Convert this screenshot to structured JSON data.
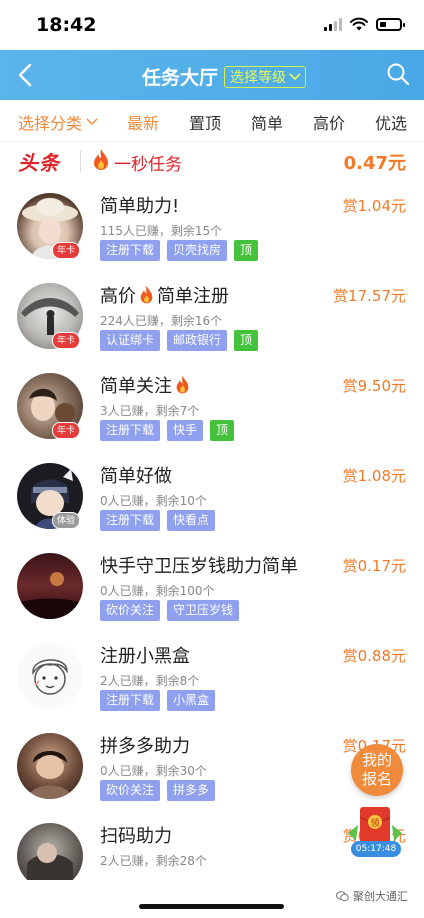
{
  "status_bar": {
    "time": "18:42"
  },
  "header": {
    "title": "任务大厅",
    "level_select": "选择等级"
  },
  "filters": {
    "category": "选择分类",
    "latest": "最新",
    "pinned": "置顶",
    "simple": "简单",
    "high_price": "高价",
    "premium": "优选"
  },
  "headline": {
    "logo": "头条",
    "text": "一秒任务",
    "price": "0.47元"
  },
  "tasks": [
    {
      "title": "简单助力!",
      "fire": false,
      "sub": "115人已赚，剩余15个",
      "price": "赏1.04元",
      "tags": [
        "注册下载",
        "贝壳找房"
      ],
      "top": "顶",
      "badge": "年卡"
    },
    {
      "title_a": "高价",
      "title_b": "简单注册",
      "sub": "224人已赚，剩余16个",
      "price": "赏17.57元",
      "tags": [
        "认证绑卡",
        "邮政银行"
      ],
      "top": "顶",
      "badge": "年卡"
    },
    {
      "title": "简单关注",
      "sub": "3人已赚，剩余7个",
      "price": "赏9.50元",
      "tags": [
        "注册下载",
        "快手"
      ],
      "top": "顶",
      "badge": "年卡"
    },
    {
      "title": "简单好做",
      "sub": "0人已赚，剩余10个",
      "price": "赏1.08元",
      "tags": [
        "注册下载",
        "快看点"
      ],
      "badge": "体验"
    },
    {
      "title": "快手守卫压岁钱助力简单",
      "sub": "0人已赚，剩余100个",
      "price": "赏0.17元",
      "tags": [
        "砍价关注",
        "守卫压岁钱"
      ]
    },
    {
      "title": "注册小黑盒",
      "sub": "2人已赚，剩余8个",
      "price": "赏0.88元",
      "tags": [
        "注册下载",
        "小黑盒"
      ]
    },
    {
      "title": "拼多多助力",
      "sub": "0人已赚，剩余30个",
      "price": "赏0.17元",
      "tags": [
        "砍价关注",
        "拼多多"
      ]
    },
    {
      "title": "扫码助力",
      "sub": "2人已赚，剩余28个",
      "price": "赏0.17元",
      "tags": []
    }
  ],
  "floating": {
    "signup_line1": "我的",
    "signup_line2": "报名",
    "envelope_label": "领",
    "timer": "05:17:48"
  },
  "watermark": "聚创大通汇",
  "colors": {
    "header": "#4aa8e6",
    "accent": "#f08a3c",
    "headline_red": "#e0242b",
    "tag": "#8ea0ee",
    "top_tag": "#44c23c"
  },
  "icons": [
    "back-icon",
    "search-icon",
    "fire-icon",
    "chevron-down-icon",
    "wechat-icon"
  ]
}
